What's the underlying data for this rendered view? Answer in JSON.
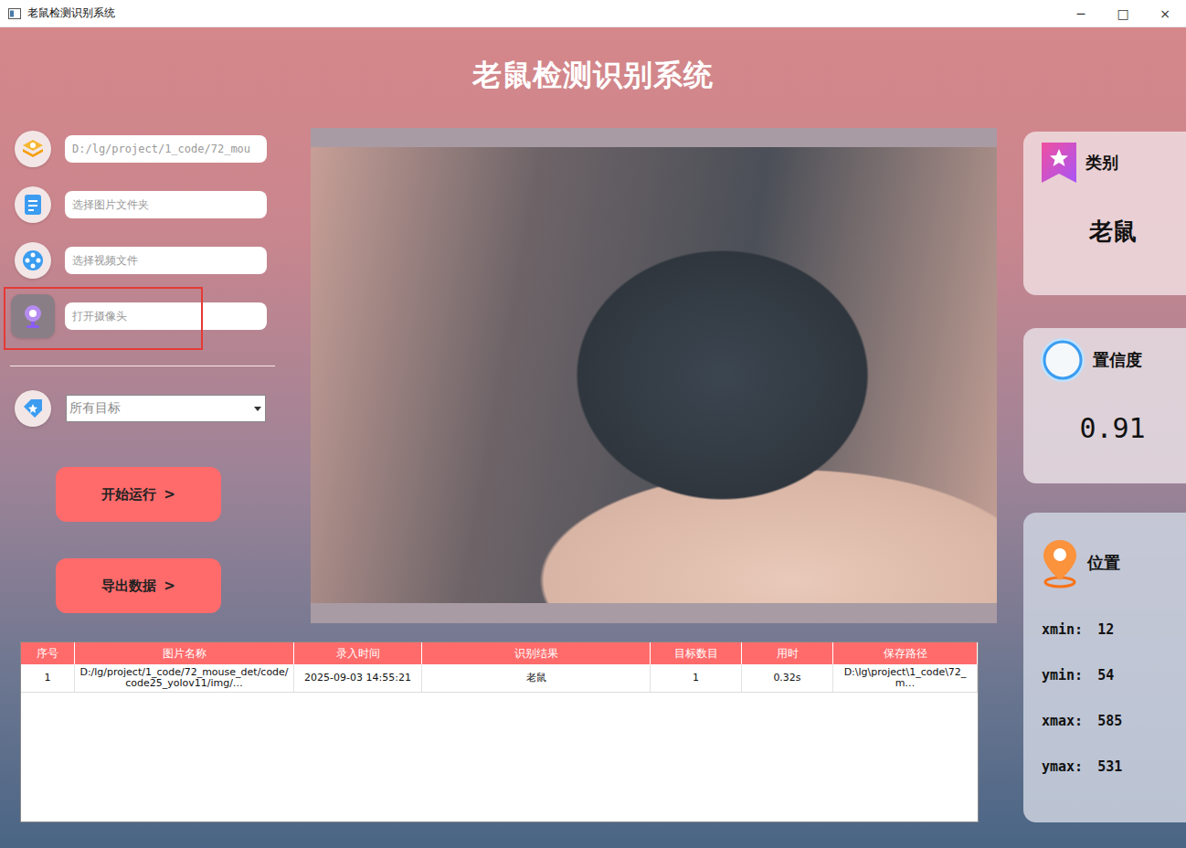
{
  "window": {
    "title": "老鼠检测识别系统",
    "controls": [
      "─",
      "□",
      "×"
    ]
  },
  "heading": "老鼠检测识别系统",
  "sources": [
    {
      "kind": "file",
      "text": "D:/lg/project/1_code/72_mou",
      "highlighted": false
    },
    {
      "kind": "folder",
      "text": "选择图片文件夹",
      "highlighted": false
    },
    {
      "kind": "video",
      "text": "选择视频文件",
      "highlighted": false
    },
    {
      "kind": "camera",
      "text": "打开摄像头",
      "highlighted": true
    }
  ],
  "target_filter": {
    "value": "所有目标"
  },
  "buttons": [
    {
      "label": "开始运行",
      "chevron": ">"
    },
    {
      "label": "导出数据",
      "chevron": ">"
    }
  ],
  "class_card": {
    "label": "类别",
    "value": "老鼠"
  },
  "confidence_card": {
    "label": "置信度",
    "value": "0.91"
  },
  "position_card": {
    "label": "位置",
    "coords": [
      {
        "name": "xmin:",
        "value": "12"
      },
      {
        "name": "ymin:",
        "value": "54"
      },
      {
        "name": "xmax:",
        "value": "585"
      },
      {
        "name": "ymax:",
        "value": "531"
      }
    ]
  },
  "table": {
    "columns": [
      "序号",
      "图片名称",
      "录入时间",
      "识别结果",
      "目标数目",
      "用时",
      "保存路径"
    ],
    "rows": [
      {
        "selected": false,
        "cells": [
          "1",
          "D:/lg/project/1_code/72_mouse_det/code/code25_yolov11/img/…",
          "2025-09-03 14:55:21",
          "老鼠",
          "1",
          "0.32s",
          "D:\\lg\\project\\1_code\\72_m…"
        ]
      }
    ]
  }
}
